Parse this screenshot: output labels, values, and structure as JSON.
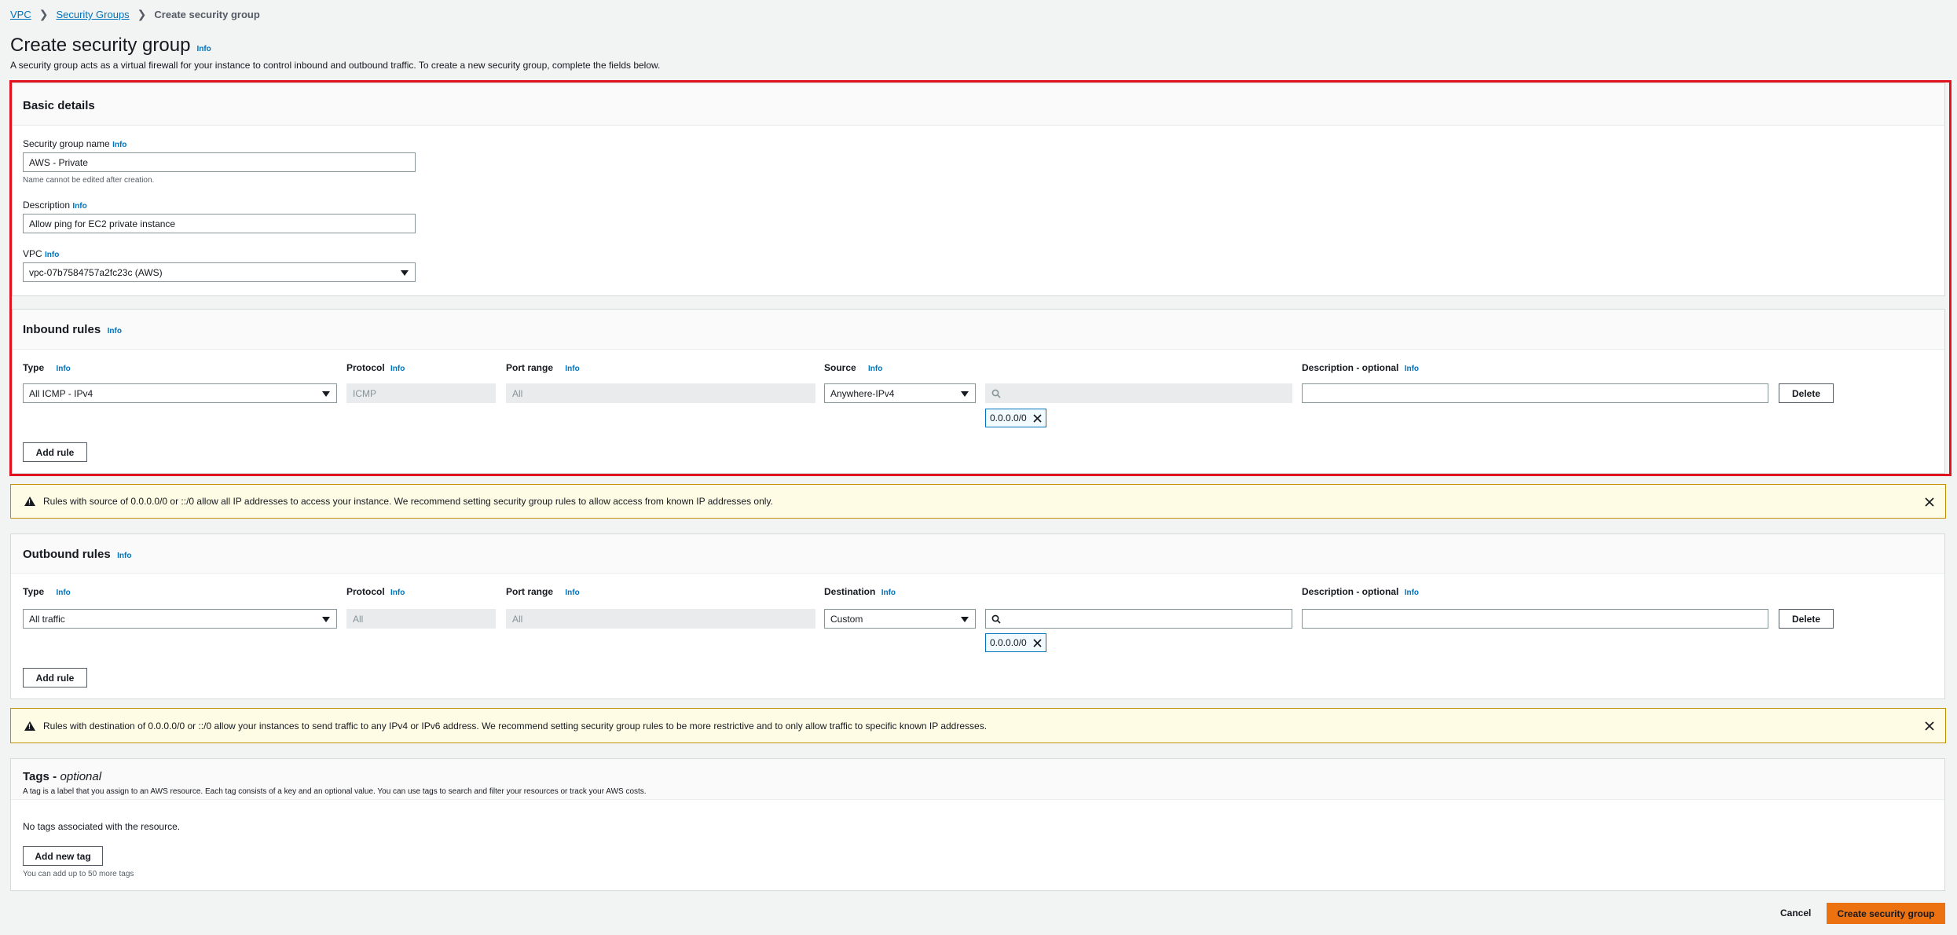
{
  "breadcrumb": {
    "vpc": "VPC",
    "security_groups": "Security Groups",
    "current": "Create security group"
  },
  "page": {
    "title": "Create security group",
    "info": "Info",
    "description": "A security group acts as a virtual firewall for your instance to control inbound and outbound traffic. To create a new security group, complete the fields below."
  },
  "basic": {
    "heading": "Basic details",
    "name_label": "Security group name",
    "name_value": "AWS - Private",
    "name_hint": "Name cannot be edited after creation.",
    "desc_label": "Description",
    "desc_value": "Allow ping for EC2 private instance",
    "vpc_label": "VPC",
    "vpc_value": "vpc-07b7584757a2fc23c (AWS)"
  },
  "columns": {
    "type": "Type",
    "protocol": "Protocol",
    "port_range": "Port range",
    "source": "Source",
    "destination": "Destination",
    "description": "Description - optional"
  },
  "inbound": {
    "heading": "Inbound rules",
    "type_value": "All ICMP - IPv4",
    "protocol_value": "ICMP",
    "port_value": "All",
    "source_value": "Anywhere-IPv4",
    "token": "0.0.0.0/0",
    "delete_label": "Delete",
    "add_rule_label": "Add rule"
  },
  "inbound_alert": "Rules with source of 0.0.0.0/0 or ::/0 allow all IP addresses to access your instance. We recommend setting security group rules to allow access from known IP addresses only.",
  "outbound": {
    "heading": "Outbound rules",
    "type_value": "All traffic",
    "protocol_value": "All",
    "port_value": "All",
    "dest_value": "Custom",
    "token": "0.0.0.0/0",
    "delete_label": "Delete",
    "add_rule_label": "Add rule"
  },
  "outbound_alert": "Rules with destination of 0.0.0.0/0 or ::/0 allow your instances to send traffic to any IPv4 or IPv6 address. We recommend setting security group rules to be more restrictive and to only allow traffic to specific known IP addresses.",
  "tags": {
    "heading": "Tags -",
    "heading_optional": "optional",
    "description": "A tag is a label that you assign to an AWS resource. Each tag consists of a key and an optional value. You can use tags to search and filter your resources or track your AWS costs.",
    "empty": "No tags associated with the resource.",
    "add_label": "Add new tag",
    "limit_hint": "You can add up to 50 more tags"
  },
  "footer": {
    "cancel": "Cancel",
    "create": "Create security group"
  },
  "colors": {
    "accent": "#0073bb",
    "primary": "#ec7211",
    "highlight": "#e0131e",
    "alert_bg": "#fffce5"
  },
  "icons": {
    "warning": "warning-icon",
    "close": "close-icon",
    "search": "search-icon",
    "dropdown": "caret-down-icon",
    "chevron": "chevron-right-icon"
  }
}
